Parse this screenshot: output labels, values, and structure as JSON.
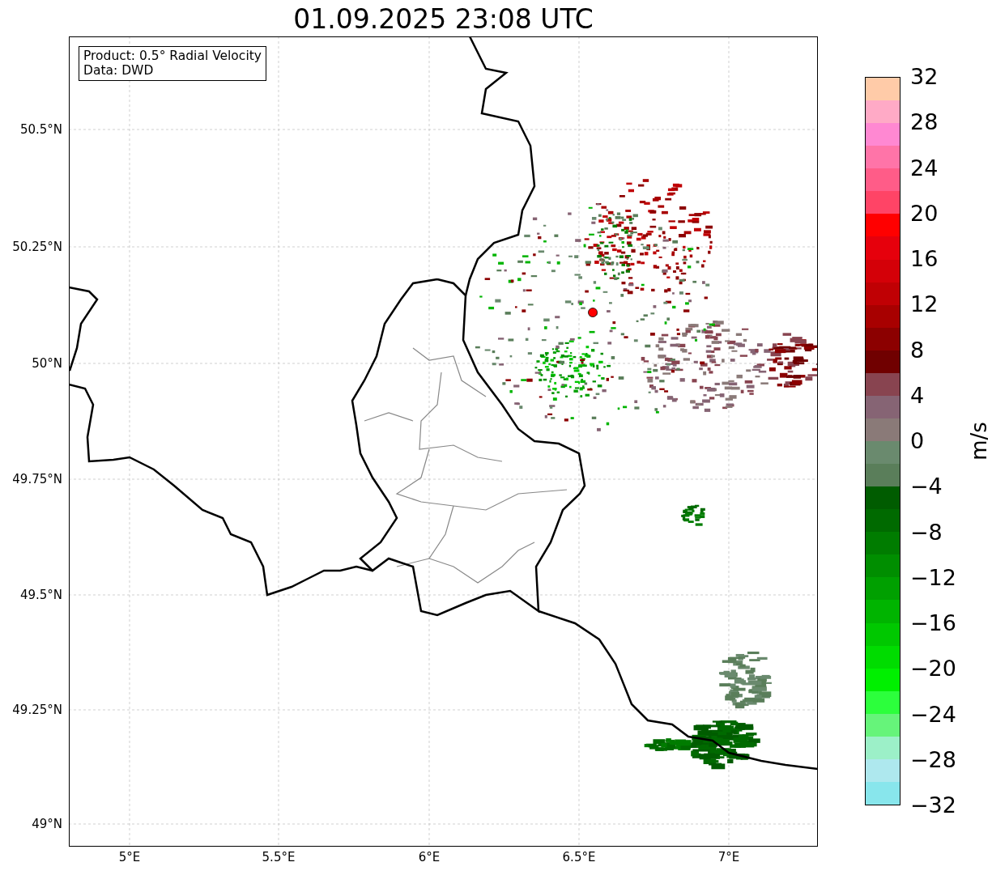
{
  "title": "01.09.2025 23:08 UTC",
  "info_box": [
    "Product: 0.5° Radial Velocity",
    "Data: DWD"
  ],
  "lat_labels": [
    "50.5°N",
    "50.25°N",
    "50°N",
    "49.75°N",
    "49.5°N",
    "49.25°N",
    "49°N"
  ],
  "lon_labels": [
    "5°E",
    "5.5°E",
    "6°E",
    "6.5°E",
    "7°E"
  ],
  "colorbar": {
    "label": "m/s",
    "ticks": [
      "32",
      "28",
      "24",
      "20",
      "16",
      "12",
      "8",
      "4",
      "0",
      "−4",
      "−8",
      "−12",
      "−16",
      "−20",
      "−24",
      "−28",
      "−32"
    ],
    "bands": [
      {
        "color": "#ffcba8"
      },
      {
        "color": "#ffaac6"
      },
      {
        "color": "#ff88d2"
      },
      {
        "color": "#ff74a8"
      },
      {
        "color": "#ff5c88"
      },
      {
        "color": "#ff4466"
      },
      {
        "color": "#ff0000"
      },
      {
        "color": "#e6000c"
      },
      {
        "color": "#d40008"
      },
      {
        "color": "#c00004"
      },
      {
        "color": "#a80000"
      },
      {
        "color": "#8c0000"
      },
      {
        "color": "#700000"
      },
      {
        "color": "#884450"
      },
      {
        "color": "#866474"
      },
      {
        "color": "#8a7a78"
      },
      {
        "color": "#6a8a6e"
      },
      {
        "color": "#5a7e5a"
      },
      {
        "color": "#005c00"
      },
      {
        "color": "#006a00"
      },
      {
        "color": "#007c00"
      },
      {
        "color": "#008e00"
      },
      {
        "color": "#00a000"
      },
      {
        "color": "#00b400"
      },
      {
        "color": "#00c800"
      },
      {
        "color": "#00dc00"
      },
      {
        "color": "#00f000"
      },
      {
        "color": "#2cff3c"
      },
      {
        "color": "#66f47a"
      },
      {
        "color": "#9cf0c8"
      },
      {
        "color": "#aee8ee"
      },
      {
        "color": "#88e6ec"
      }
    ]
  }
}
